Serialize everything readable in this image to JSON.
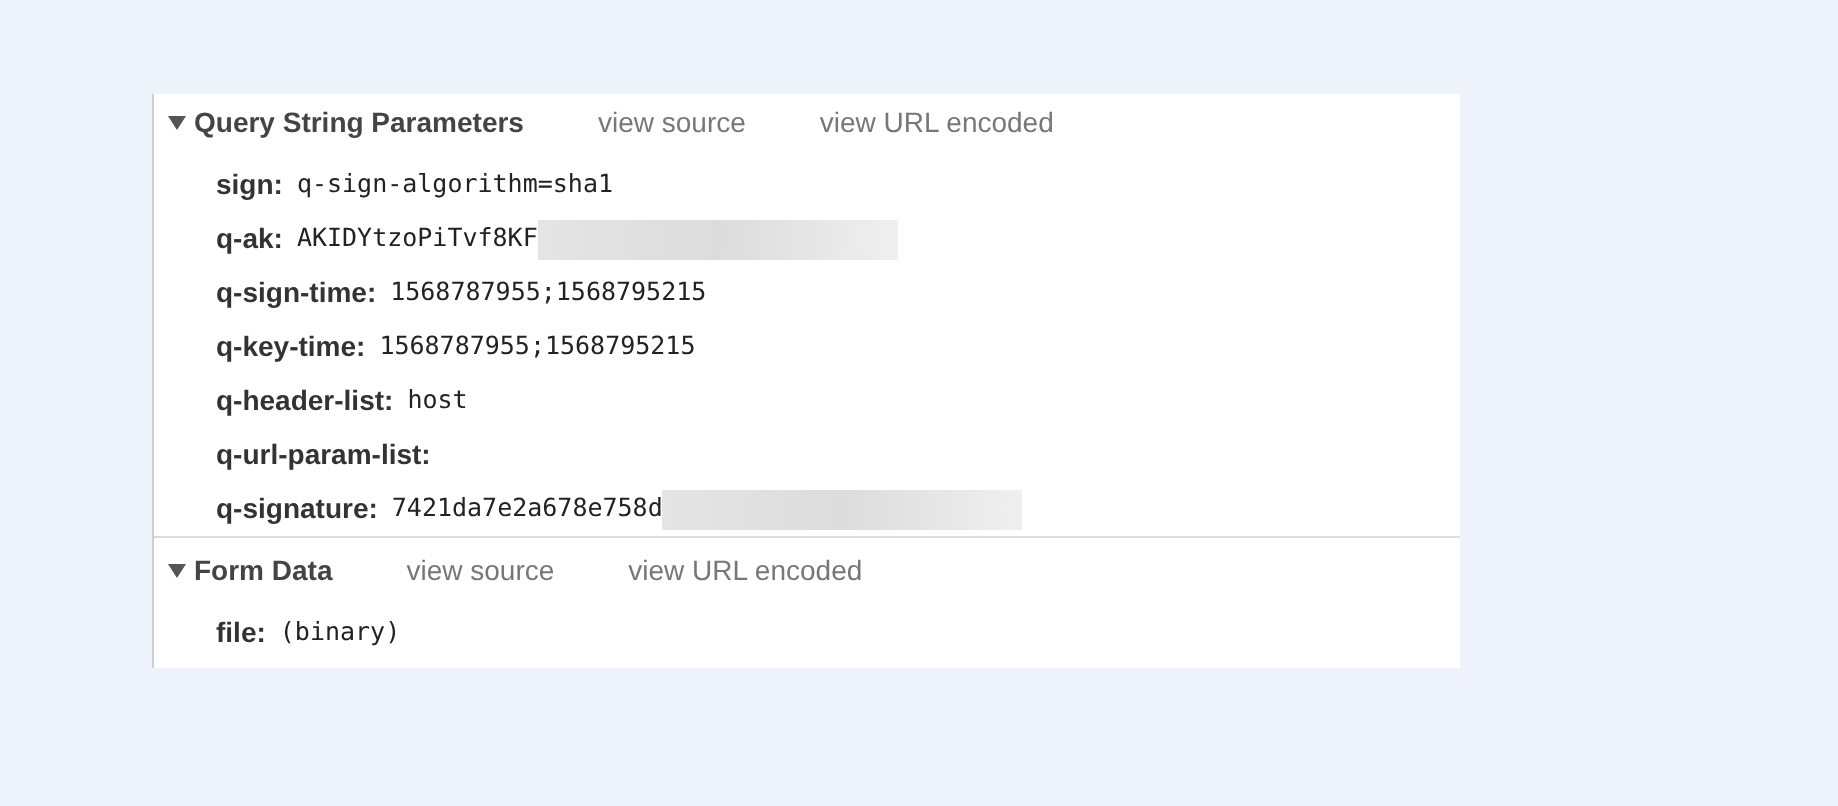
{
  "sections": [
    {
      "title": "Query String Parameters",
      "expanded": true,
      "links": [
        "view source",
        "view URL encoded"
      ],
      "params": [
        {
          "key": "sign:",
          "value": "q-sign-algorithm=sha1",
          "redacted": false
        },
        {
          "key": "q-ak:",
          "value": "AKIDYtzoPiTvf8KF",
          "redacted": true
        },
        {
          "key": "q-sign-time:",
          "value": "1568787955;1568795215",
          "redacted": false
        },
        {
          "key": "q-key-time:",
          "value": "1568787955;1568795215",
          "redacted": false
        },
        {
          "key": "q-header-list:",
          "value": "host",
          "redacted": false
        },
        {
          "key": "q-url-param-list:",
          "redacted": false
        },
        {
          "key": "q-signature:",
          "value": "7421da7e2a678e758d",
          "redacted": true
        }
      ]
    },
    {
      "title": "Form Data",
      "expanded": true,
      "links": [
        "view source",
        "view URL encoded"
      ],
      "params": [
        {
          "key": "file:",
          "value": "(binary)",
          "redacted": false
        }
      ]
    }
  ]
}
